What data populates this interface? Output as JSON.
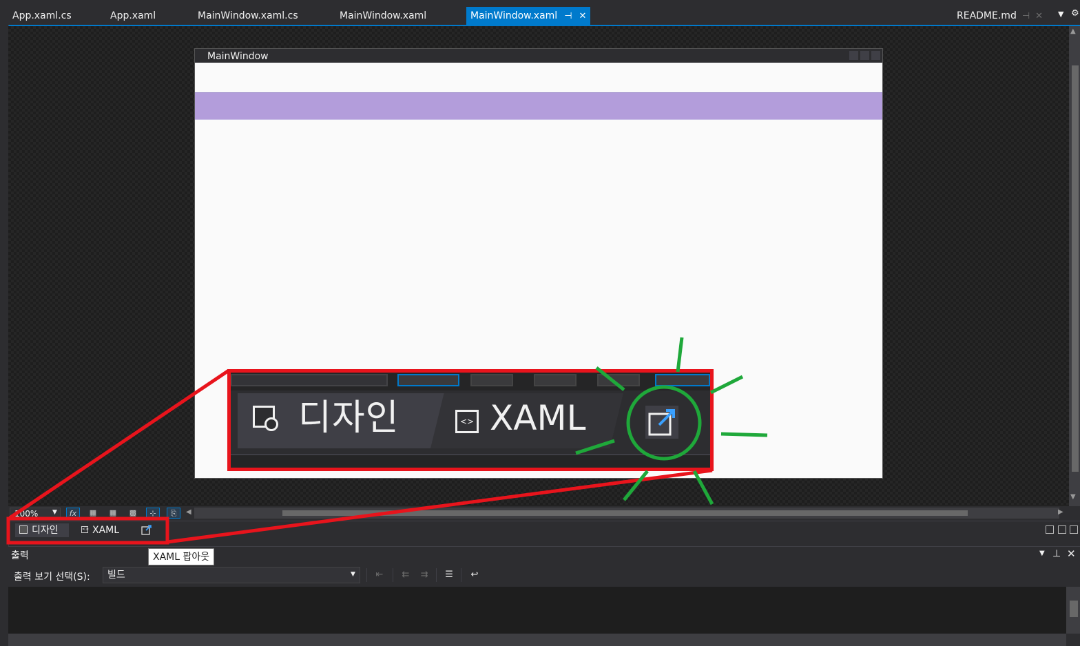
{
  "doc_tabs": [
    {
      "label": "App.xaml.cs"
    },
    {
      "label": "App.xaml"
    },
    {
      "label": "MainWindow.xaml.cs"
    },
    {
      "label": "MainWindow.xaml"
    },
    {
      "label": "MainWindow.xaml",
      "active": true,
      "pin_icon": "pin-icon",
      "close_icon": "close-icon"
    },
    {
      "label": "README.md"
    }
  ],
  "designer": {
    "window_title": "MainWindow",
    "band_color": "#b39ddb",
    "zoom": "100%"
  },
  "split_bar": {
    "design_label": "디자인",
    "xaml_label": "XAML",
    "popout_tooltip": "XAML 팝아웃"
  },
  "output": {
    "title": "출력",
    "select_label": "출력 보기 선택(S):",
    "selected_source": "빌드"
  },
  "callout": {
    "design_label": "디자인",
    "xaml_label": "XAML",
    "frame_color": "#e8141c",
    "highlight_color": "#1fa83a"
  },
  "colors": {
    "accent": "#007acc",
    "background": "#2d2d30",
    "canvas": "#1e1e1e"
  }
}
